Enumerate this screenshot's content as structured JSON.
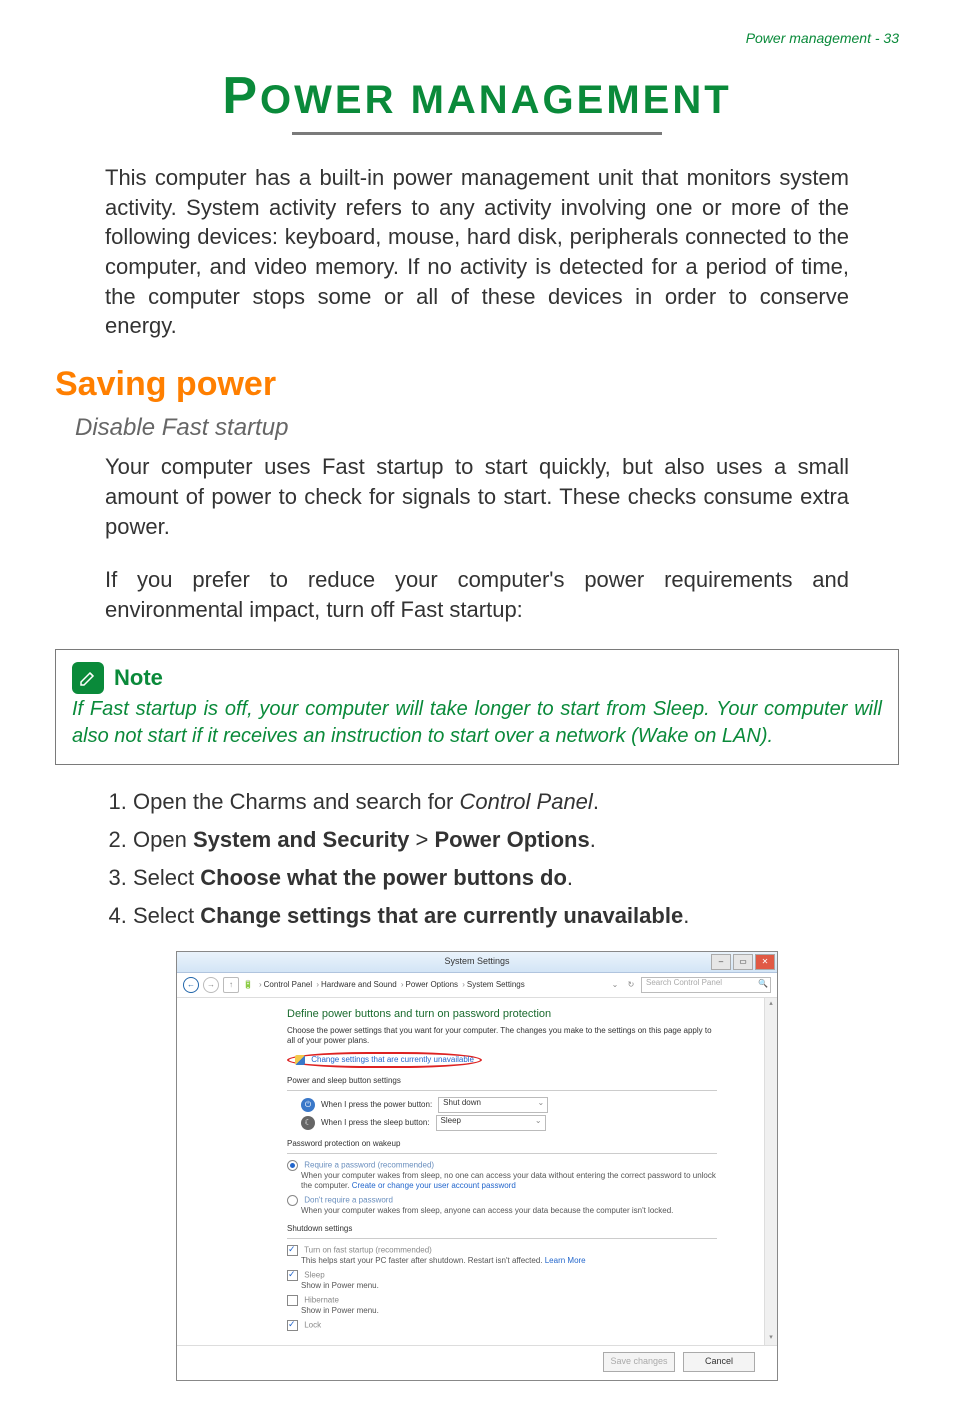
{
  "header": {
    "right": "Power management - 33"
  },
  "title": {
    "first": "P",
    "rest": "OWER MANAGEMENT"
  },
  "intro": "This computer has a built-in power management unit that monitors system activity. System activity refers to any activity involving one or more of the following devices: keyboard, mouse, hard disk, peripherals connected to the computer, and video memory. If no activity is detected for a period of time, the computer stops some or all of these devices in order to conserve energy.",
  "h1": "Saving power",
  "h2": "Disable Fast startup",
  "p1": "Your computer uses Fast startup to start quickly, but also uses a small amount of power to check for signals to start. These checks consume extra power.",
  "p2": "If you prefer to reduce your computer's power requirements and environmental impact, turn off Fast startup:",
  "note": {
    "title": "Note",
    "body": "If Fast startup is off, your computer will take longer to start from Sleep. Your computer will also not start if it receives an instruction to start over a network (Wake on LAN)."
  },
  "steps": {
    "s1a": "Open the Charms and search for ",
    "s1b": "Control Panel",
    "s1c": ".",
    "s2a": "Open ",
    "s2b": "System and Security",
    "s2c": " > ",
    "s2d": "Power Options",
    "s2e": ".",
    "s3a": "Select ",
    "s3b": "Choose what the power buttons do",
    "s3c": ".",
    "s4a": "Select ",
    "s4b": "Change settings that are currently unavailable",
    "s4c": "."
  },
  "win": {
    "title": "System Settings",
    "crumbs": {
      "c1": "Control Panel",
      "c2": "Hardware and Sound",
      "c3": "Power Options",
      "c4": "System Settings"
    },
    "search_placeholder": "Search Control Panel",
    "refresh_label": "Ċ",
    "section_title": "Define power buttons and turn on password protection",
    "section_desc": "Choose the power settings that you want for your computer. The changes you make to the settings on this page apply to all of your power plans.",
    "change_link": "Change settings that are currently unavailable",
    "subhead1": "Power and sleep button settings",
    "row1_label": "When I press the power button:",
    "row1_value": "Shut down",
    "row2_label": "When I press the sleep button:",
    "row2_value": "Sleep",
    "subhead2": "Password protection on wakeup",
    "opt1_title": "Require a password (recommended)",
    "opt1_desc_a": "When your computer wakes from sleep, no one can access your data without entering the correct password to unlock the computer. ",
    "opt1_link": "Create or change your user account password",
    "opt2_title": "Don't require a password",
    "opt2_desc": "When your computer wakes from sleep, anyone can access your data because the computer isn't locked.",
    "subhead3": "Shutdown settings",
    "ss1_label": "Turn on fast startup (recommended)",
    "ss1_desc_a": "This helps start your PC faster after shutdown. Restart isn't affected. ",
    "ss1_link": "Learn More",
    "ss2_label": "Sleep",
    "ss2_desc": "Show in Power menu.",
    "ss3_label": "Hibernate",
    "ss3_desc": "Show in Power menu.",
    "ss4_label": "Lock",
    "btn_save": "Save changes",
    "btn_cancel": "Cancel",
    "min": "–",
    "max": "▭",
    "close": "✕"
  }
}
